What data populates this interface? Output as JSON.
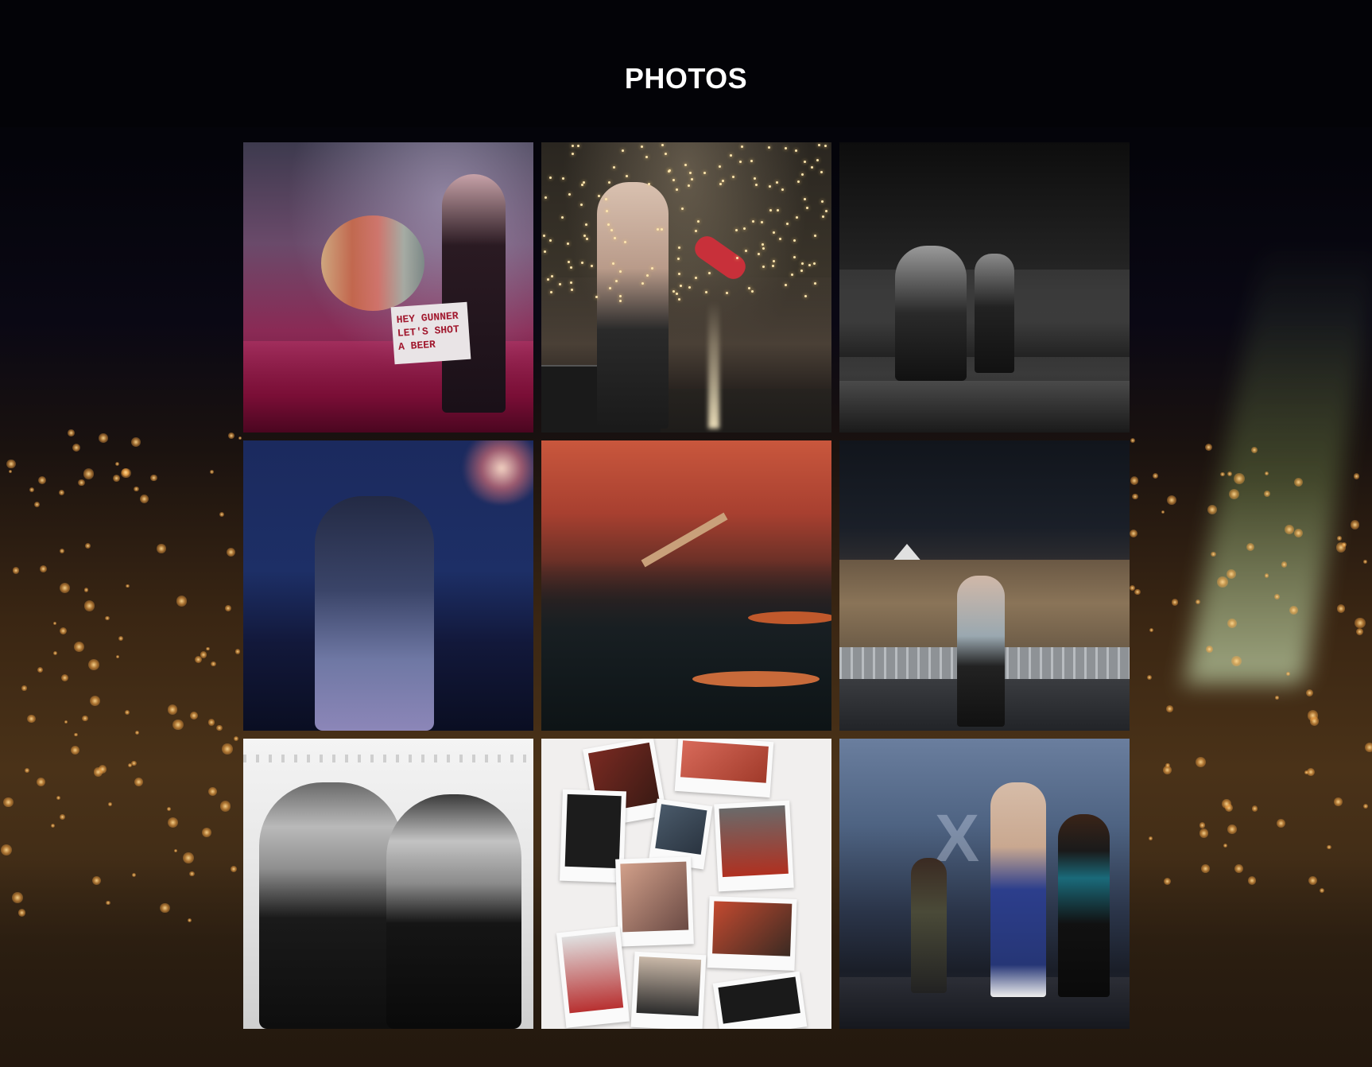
{
  "page": {
    "title": "PHOTOS"
  },
  "photos": [
    {
      "name": "photo-1",
      "description_icon": "concert-red-photo"
    },
    {
      "name": "photo-2",
      "description_icon": "concert-sparks-photo"
    },
    {
      "name": "photo-3",
      "description_icon": "stage-bw-photo"
    },
    {
      "name": "photo-4",
      "description_icon": "fireworks-photo"
    },
    {
      "name": "photo-5",
      "description_icon": "drums-smoke-photo"
    },
    {
      "name": "photo-6",
      "description_icon": "crowd-photo"
    },
    {
      "name": "photo-7",
      "description_icon": "selfie-bw-photo"
    },
    {
      "name": "photo-8",
      "description_icon": "polaroids-photo"
    },
    {
      "name": "photo-9",
      "description_icon": "stage-blue-photo"
    }
  ],
  "photo_1_sign": "HEY GUNNER LET'S SHOT A BEER",
  "colors": {
    "header_bg": "#030307",
    "title": "#ffffff"
  }
}
